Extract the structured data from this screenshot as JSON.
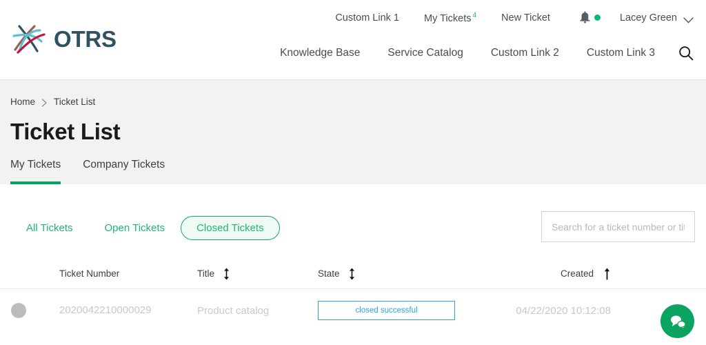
{
  "header": {
    "logo_text": "OTRS",
    "top_nav": [
      {
        "label": "Custom Link 1",
        "badge": ""
      },
      {
        "label": "My Tickets",
        "badge": "4"
      },
      {
        "label": "New Ticket",
        "badge": ""
      }
    ],
    "notifications": {
      "icon": "bell-icon",
      "status_dot_color": "#0fb573"
    },
    "user": {
      "name": "Lacey Green",
      "chevron_icon": "chevron-down-icon"
    },
    "second_nav": [
      {
        "label": "Knowledge Base"
      },
      {
        "label": "Service Catalog"
      },
      {
        "label": "Custom Link 2"
      },
      {
        "label": "Custom Link 3"
      }
    ],
    "search_icon": "search-icon"
  },
  "breadcrumb": {
    "items": [
      {
        "label": "Home"
      },
      {
        "label": "Ticket List"
      }
    ],
    "separator_icon": "chevron-right-icon"
  },
  "page": {
    "title": "Ticket List"
  },
  "tabs": [
    {
      "label": "My Tickets",
      "active": true
    },
    {
      "label": "Company Tickets",
      "active": false
    }
  ],
  "filters": [
    {
      "label": "All Tickets",
      "active": false
    },
    {
      "label": "Open Tickets",
      "active": false
    },
    {
      "label": "Closed Tickets",
      "active": true
    }
  ],
  "search": {
    "placeholder": "Search for a ticket number or title",
    "value": ""
  },
  "table": {
    "columns": [
      {
        "label": "",
        "sort": "none"
      },
      {
        "label": "Ticket Number",
        "sort": "none"
      },
      {
        "label": "Title",
        "sort": "both"
      },
      {
        "label": "State",
        "sort": "both"
      },
      {
        "label": "Created",
        "sort": "asc"
      }
    ],
    "rows": [
      {
        "status_dot_color": "#bcbcbc",
        "ticket_number": "2020042210000029",
        "title": "Product catalog",
        "state": "closed successful",
        "state_color": "#29a3e0",
        "created": "04/22/2020 10:12:08"
      }
    ]
  },
  "chat_button": {
    "icon": "chat-bubbles-icon",
    "color": "#0ba360"
  },
  "theme": {
    "accent_green": "#00a65a",
    "link_green": "#22b573",
    "band_gray": "#f2f2f2",
    "text_dark": "#3d3d3d",
    "muted_text": "#c8c8c8"
  }
}
